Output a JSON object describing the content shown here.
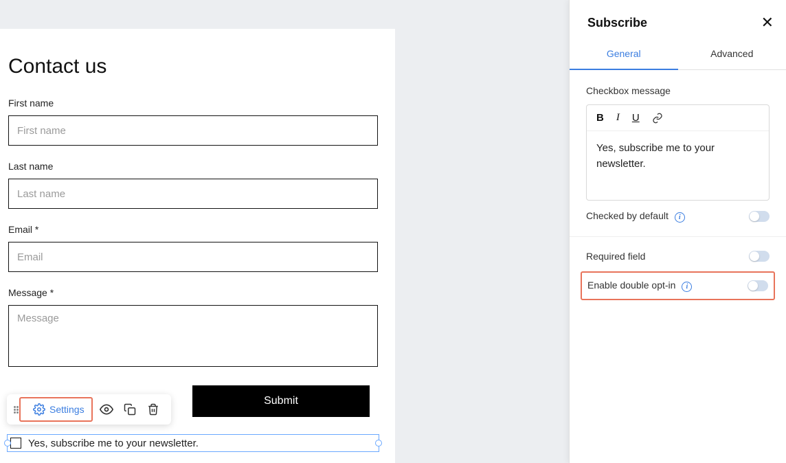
{
  "form": {
    "title": "Contact us",
    "first_name_label": "First name",
    "first_name_placeholder": "First name",
    "last_name_label": "Last name",
    "last_name_placeholder": "Last name",
    "email_label": "Email *",
    "email_placeholder": "Email",
    "message_label": "Message *",
    "message_placeholder": "Message",
    "submit_label": "Submit",
    "subscribe_label": "Yes, subscribe me to your newsletter."
  },
  "toolbar": {
    "settings_label": "Settings"
  },
  "panel": {
    "title": "Subscribe",
    "tab_general": "General",
    "tab_advanced": "Advanced",
    "checkbox_message_label": "Checkbox message",
    "checkbox_message_value": "Yes, subscribe me to your newsletter.",
    "checked_by_default_label": "Checked by default",
    "required_field_label": "Required field",
    "enable_double_optin_label": "Enable double opt-in"
  }
}
